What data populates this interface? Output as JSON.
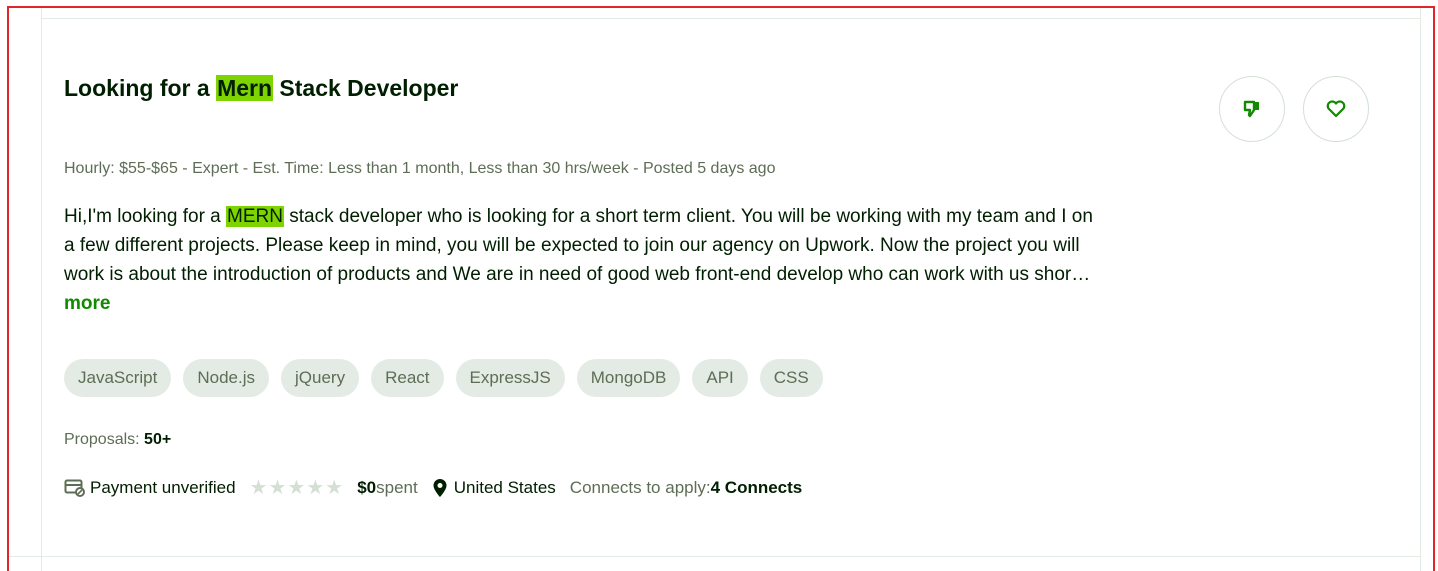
{
  "job": {
    "title_before": "Looking for a ",
    "title_highlight": "Mern",
    "title_after": " Stack Developer",
    "meta": {
      "rate_label": "Hourly: ",
      "rate_value": "$55-$65",
      "rest": " - Expert - Est. Time: Less than 1 month, Less than 30 hrs/week - Posted 5 days ago"
    },
    "description": {
      "line1_before": "Hi,I'm looking for a ",
      "line1_highlight": "MERN",
      "line1_after": " stack developer who is looking for a short term client. You will be working with my team and I on",
      "line2": "a few different projects. Please keep in mind, you will be expected to join our agency on Upwork. Now the project you will",
      "line3": "work is about the introduction of products and We are in need of good web front-end develop who can work with us shor…",
      "more": "more"
    },
    "skills": [
      "JavaScript",
      "Node.js",
      "jQuery",
      "React",
      "ExpressJS",
      "MongoDB",
      "API",
      "CSS"
    ],
    "proposals": {
      "label": "Proposals: ",
      "value": "50+"
    },
    "client": {
      "payment": "Payment unverified",
      "rating_stars": 5,
      "spent_value": "$0",
      "spent_label": " spent",
      "country": "United States",
      "connects_label": "Connects to apply: ",
      "connects_value": "4 Connects"
    }
  },
  "colors": {
    "highlight": "#7ed400",
    "accent": "#108a00",
    "frame": "#e0252b",
    "muted_text": "#5e6d55",
    "tag_bg": "#e4ebe4"
  },
  "icons": {
    "dislike": "thumbs-down-icon",
    "like": "heart-icon",
    "payment": "payment-card-icon",
    "star": "star-icon",
    "location": "location-pin-icon"
  }
}
